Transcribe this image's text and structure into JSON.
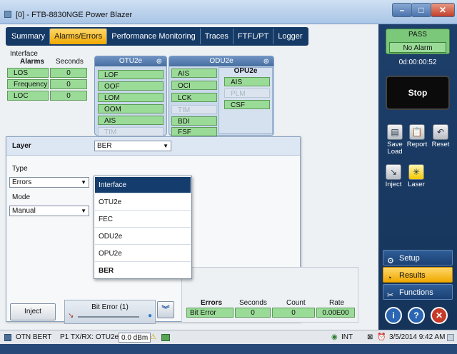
{
  "window": {
    "title": "[0] - FTB-8830NGE Power Blazer"
  },
  "tabs": [
    {
      "label": "Summary",
      "active": false
    },
    {
      "label": "Alarms/Errors",
      "active": true
    },
    {
      "label": "Performance Monitoring",
      "active": false
    },
    {
      "label": "Traces",
      "active": false
    },
    {
      "label": "FTFL/PT",
      "active": false
    },
    {
      "label": "Logger",
      "active": false
    }
  ],
  "interface": {
    "title": "Interface",
    "col_alarms": "Alarms",
    "col_seconds": "Seconds",
    "rows": [
      {
        "label": "LOS",
        "value": "0"
      },
      {
        "label": "Frequency",
        "value": "0"
      },
      {
        "label": "LOC",
        "value": "0"
      }
    ]
  },
  "otu": {
    "title": "OTU2e",
    "signals": [
      "LOF",
      "OOF",
      "LOM",
      "OOM",
      "AIS",
      "TIM"
    ]
  },
  "odu": {
    "title": "ODU2e",
    "signals": [
      "AIS",
      "OCI",
      "LCK",
      "TIM",
      "BDI",
      "FSF"
    ]
  },
  "opu": {
    "title": "OPU2e",
    "signals": [
      "AIS",
      "PLM",
      "CSF"
    ]
  },
  "layer_panel": {
    "layer_label": "Layer",
    "layer_value": "BER",
    "type_label": "Type",
    "type_value": "Errors",
    "mode_label": "Mode",
    "mode_value": "Manual"
  },
  "dropdown": {
    "options": [
      {
        "label": "Interface",
        "selected": true
      },
      {
        "label": "OTU2e"
      },
      {
        "label": "FEC"
      },
      {
        "label": "ODU2e"
      },
      {
        "label": "OPU2e"
      },
      {
        "label": "BER",
        "bold": true
      }
    ]
  },
  "results": {
    "col_errors": "Errors",
    "col_seconds": "Seconds",
    "col_count": "Count",
    "col_rate": "Rate",
    "row": {
      "label": "Bit Error",
      "seconds": "0",
      "count": "0",
      "rate": "0.00E00"
    }
  },
  "inject": {
    "button_label": "Inject",
    "bit_error_label": "Bit Error (1)"
  },
  "right_panel": {
    "status": "PASS",
    "alarm_state": "No Alarm",
    "timer": "0d:00:00:52",
    "stop_label": "Stop",
    "tools": [
      {
        "label": "Save Load",
        "icon": "save-load-icon"
      },
      {
        "label": "Report",
        "icon": "report-icon"
      },
      {
        "label": "Reset",
        "icon": "reset-icon"
      },
      {
        "label": "Inject",
        "icon": "inject-icon"
      },
      {
        "label": "Laser",
        "icon": "laser-icon"
      }
    ],
    "nav": [
      {
        "label": "Setup",
        "active": false
      },
      {
        "label": "Results",
        "active": true
      },
      {
        "label": "Functions",
        "active": false
      }
    ]
  },
  "statusbar": {
    "test_name": "OTN BERT",
    "port": "P1  TX/RX: OTU2e",
    "power": "0.0 dBm",
    "clock": "INT",
    "datetime": "3/5/2014 9:42 AM"
  },
  "colors": {
    "ok_green": "#9bdb98",
    "accent_yellow": "#f0a800",
    "nav_blue": "#163a66"
  }
}
